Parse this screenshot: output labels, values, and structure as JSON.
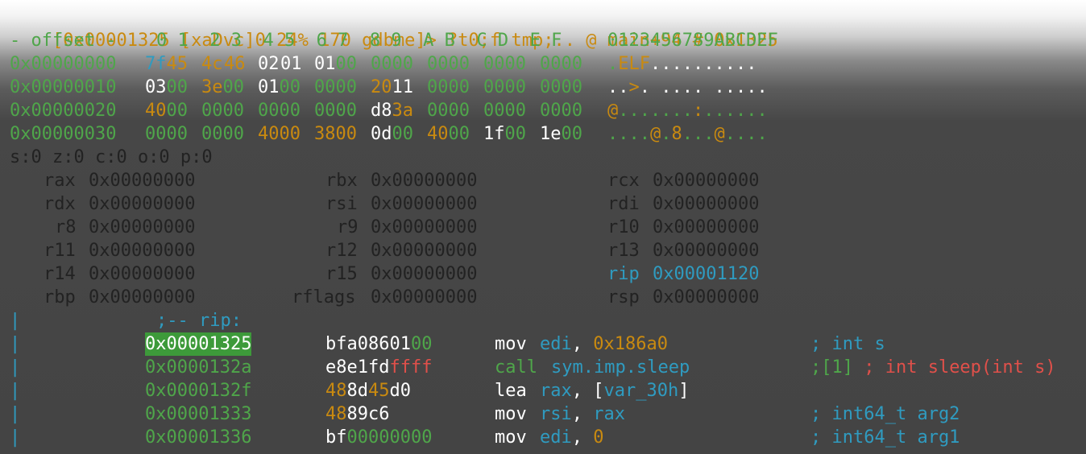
{
  "prompt": {
    "left": "[0x00001325 [xaDvc]0 24% 170 gdbme]> ",
    "cmd": "?t0;f tmp;.. @ main+94 # 0x1325"
  },
  "hex_header": {
    "offset": "- offset -",
    "cols": "0 1  2 3  4 5  6 7  8 9  A B  C D  E F",
    "ascii": "0123456789ABCDEF"
  },
  "hexdump": [
    {
      "addr": "0x00000000",
      "g1": [
        "7f",
        "45"
      ],
      "g2": [
        "4c",
        "46"
      ],
      "g3": [
        "02",
        "01"
      ],
      "g4": [
        "01",
        "00"
      ],
      "g5": "0000",
      "g6": "0000",
      "g7": "0000",
      "g8": "0000",
      "ascii": [
        ".",
        "ELF",
        ".........."
      ]
    },
    {
      "addr": "0x00000010",
      "g1": [
        "03",
        "00"
      ],
      "g2": [
        "3e",
        "00"
      ],
      "g3": [
        "01",
        "00"
      ],
      "g4": "0000",
      "g5": [
        "20",
        "11"
      ],
      "g6": "0000",
      "g7": "0000",
      "g8": "0000",
      "ascii": [
        "..",
        ">",
        ". .... ....."
      ]
    },
    {
      "addr": "0x00000020",
      "g1": [
        "40",
        "00"
      ],
      "g2": "0000",
      "g3": "0000",
      "g4": "0000",
      "g5": [
        "d8",
        "3a"
      ],
      "g6": "0000",
      "g7": "0000",
      "g8": "0000",
      "ascii": [
        "@",
        ".......",
        ":",
        "......"
      ]
    },
    {
      "addr": "0x00000030",
      "g1": "0000",
      "g2": "0000",
      "g3": [
        "40",
        "00"
      ],
      "g4": [
        "38",
        "00"
      ],
      "g5": [
        "0d",
        "00"
      ],
      "g6": [
        "40",
        "00"
      ],
      "g7": [
        "1f",
        "00"
      ],
      "g8": [
        "1e",
        "00"
      ],
      "ascii": [
        "....",
        "@",
        ".",
        "8",
        "...",
        "@",
        "...."
      ]
    }
  ],
  "flags": "s:0 z:0 c:0 o:0 p:0",
  "registers": [
    [
      {
        "name": "rax",
        "val": "0x00000000"
      },
      {
        "name": "rbx",
        "val": "0x00000000"
      },
      {
        "name": "rcx",
        "val": "0x00000000"
      }
    ],
    [
      {
        "name": "rdx",
        "val": "0x00000000"
      },
      {
        "name": "rsi",
        "val": "0x00000000"
      },
      {
        "name": "rdi",
        "val": "0x00000000"
      }
    ],
    [
      {
        "name": "r8",
        "val": "0x00000000"
      },
      {
        "name": "r9",
        "val": "0x00000000"
      },
      {
        "name": "r10",
        "val": "0x00000000"
      }
    ],
    [
      {
        "name": "r11",
        "val": "0x00000000"
      },
      {
        "name": "r12",
        "val": "0x00000000"
      },
      {
        "name": "r13",
        "val": "0x00000000"
      }
    ],
    [
      {
        "name": "r14",
        "val": "0x00000000"
      },
      {
        "name": "r15",
        "val": "0x00000000"
      },
      {
        "name": "rip",
        "val": "0x00001120"
      }
    ],
    [
      {
        "name": "rbp",
        "val": "0x00000000"
      },
      {
        "name": "rflags",
        "val": "0x00000000"
      },
      {
        "name": "rsp",
        "val": "0x00000000"
      }
    ]
  ],
  "disasm": {
    "bar": "|",
    "label": ";-- rip:",
    "rows": [
      {
        "addr": "0x00001325",
        "bytes": [
          "bfa08601",
          "00"
        ],
        "mn": "mov",
        "ops": [
          "edi",
          ", ",
          "0x186a0"
        ],
        "comment": [
          "; int s"
        ]
      },
      {
        "addr": "0x0000132a",
        "bytes": [
          "e8e1fd",
          "ffff"
        ],
        "mn": "call",
        "ops": [
          "sym.imp.sleep"
        ],
        "comment": [
          ";[1]",
          " ; int sleep(int s)"
        ]
      },
      {
        "addr": "0x0000132f",
        "bytes": [
          "48",
          "8d",
          "45",
          "d0"
        ],
        "mn": "lea",
        "ops": [
          "rax",
          ", [",
          "var_30h",
          "]"
        ],
        "comment": []
      },
      {
        "addr": "0x00001333",
        "bytes": [
          "48",
          "89c6"
        ],
        "mn": "mov",
        "ops": [
          "rsi",
          ", ",
          "rax"
        ],
        "comment": [
          "; int64_t arg2"
        ]
      },
      {
        "addr": "0x00001336",
        "bytes": [
          "bf",
          "00000000"
        ],
        "mn": "mov",
        "ops": [
          "edi",
          ", ",
          "0"
        ],
        "comment": [
          "; int64_t arg1"
        ]
      }
    ]
  }
}
